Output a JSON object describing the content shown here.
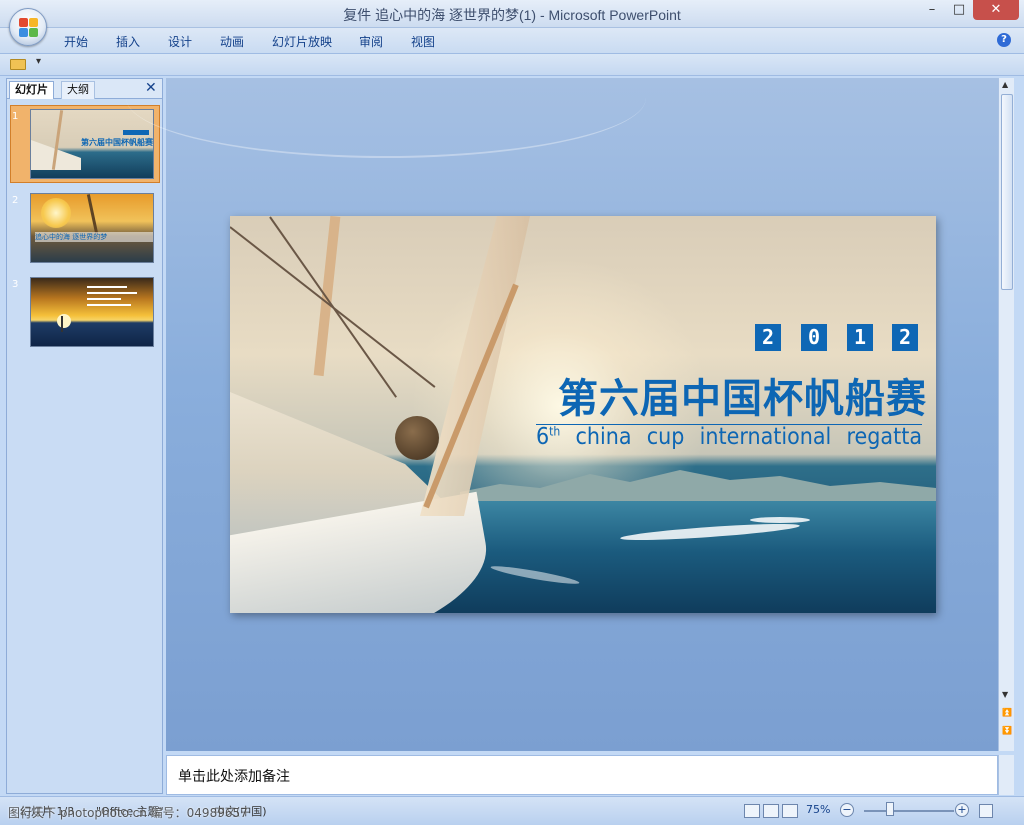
{
  "window": {
    "title": "复件 追心中的海 逐世界的梦(1) - Microsoft PowerPoint",
    "minimize": "–",
    "maximize": "□",
    "close": "✕"
  },
  "ribbon": {
    "tabs": [
      "开始",
      "插入",
      "设计",
      "动画",
      "幻灯片放映",
      "审阅",
      "视图"
    ],
    "help": "?"
  },
  "quick_access": {
    "dropdown": "▾"
  },
  "slides_panel": {
    "tab_slides": "幻灯片",
    "tab_outline": "大纲",
    "close": "✕",
    "thumbnails": [
      {
        "number": "1",
        "caption": "第六届中国杯帆船赛",
        "selected": true
      },
      {
        "number": "2",
        "caption": "追心中的海 逐世界的梦",
        "selected": false
      },
      {
        "number": "3",
        "caption": "",
        "selected": false
      }
    ]
  },
  "slide": {
    "year_digits": [
      "2",
      "0",
      "1",
      "2"
    ],
    "title": "第六届中国杯帆船赛",
    "subtitle_num": "6",
    "subtitle_sup": "th",
    "subtitle_words": [
      "china",
      "cup",
      "international",
      "regatta"
    ],
    "colors": {
      "title": "#0d66b4",
      "year_box": "#0e67b5"
    }
  },
  "notes": {
    "placeholder": "单击此处添加备注"
  },
  "status": {
    "slide_info": "幻灯片 1/3",
    "theme": "\"Office 主题\"",
    "language": "中文(中国)",
    "zoom": "75%",
    "zoom_out": "−",
    "zoom_in": "+"
  },
  "watermark": "图行天下 photophoto.cn  编号：04989657"
}
